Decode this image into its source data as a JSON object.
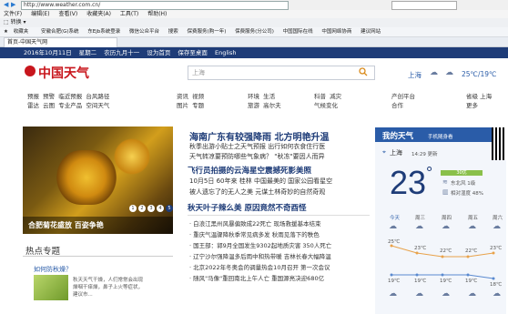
{
  "browser": {
    "address": "http://www.weather.com.cn/",
    "menu": [
      "文件(F)",
      "编辑(E)",
      "查看(V)",
      "收藏夹(A)",
      "工具(T)",
      "帮助(H)"
    ],
    "toolbar_label": "转换",
    "favorites": [
      "收藏夹",
      "安徽合肥(G)系统",
      "东Ejb系统登录",
      "微信公众平台",
      "搜索",
      "保费服务(购一年)",
      "保费服务(分公司)",
      "中国国际在线",
      "中国网络协商",
      "建议网站"
    ],
    "tab_label": "首页-中国天气网"
  },
  "site": {
    "topstrip": {
      "date": "2016年10月11日",
      "weekday": "星期二",
      "lunar": "农历九月十一",
      "set_home": "设为首页",
      "save_desktop": "保存至桌面",
      "english": "English"
    },
    "logo": "中国天气",
    "search": {
      "placeholder": "上海"
    },
    "top_weather": {
      "city": "上海",
      "temp": "25℃/19℃"
    },
    "nav": {
      "col1": [
        "预报",
        "雷达",
        "预警",
        "云图",
        "临近预报",
        "专业产品",
        "台风路径",
        "空间天气"
      ],
      "col2": [
        "资讯",
        "视频",
        "图片",
        "专题"
      ],
      "col3": [
        "环境",
        "生活",
        "旅游",
        "高尔夫"
      ],
      "col4": [
        "科普",
        "气候变化",
        "减灾"
      ],
      "col5": [
        "产创平台",
        "合作"
      ],
      "col6": [
        "省级",
        "上海",
        "更多"
      ]
    },
    "hero": {
      "caption": "合肥菊花盛放 百姿争艳",
      "dots": [
        "1",
        "2",
        "3",
        "4",
        "5"
      ]
    },
    "headlines": {
      "main": "海南广东有较强降雨 北方明艳升温",
      "main_lines": [
        "秋季出游小贴士之天气预报 出行如何衣食住行医",
        "天气转凉要预防哪些气象病？",
        "\"秋冻\"要因人而异"
      ],
      "second": "飞行员拍摄的云海星空震撼死影美照",
      "second_lines": [
        "10月5日 60年来 桂林 中国最美的 国家公园看星空",
        "被人遗忘了的无人之美 元谋土林奇妙的自然奇观"
      ],
      "third": "秋天叶子辣么美 原因竟然不奇酉怪",
      "bullets": [
        "白浪江黑州风暴偏致成22死亡 现场救援基本结束",
        "重庆气温骤降秋季常见病多发 秋雨见落下的秩色",
        "国王部：郭9月全国发生9302起地质灾害 350人死亡",
        "辽宁沙尔强降温多后雨中和热带暖 吉林长春大幅降温",
        "北京2022年冬奥会的调量热会10月召开 第一次会议",
        "随风\"马像\"重回南北上午人亡 重国源亮决迎680亿"
      ]
    },
    "hot": {
      "title": "热点专题",
      "link": "如何防秋燥？",
      "card_lines": [
        "秋天天气干燥，人们常常会出现",
        "燥咽干痒燥，鼻子上火等症状，",
        "建议市..."
      ]
    },
    "my_weather": {
      "title": "我的天气",
      "subtitle": "手机随身看",
      "city": "上海",
      "update": "14:29 更新",
      "temp": "23",
      "unit": "°",
      "aqi": "30优",
      "wind": "东北风 1级",
      "humidity": "相对湿度 48%",
      "days": [
        "今天",
        "周三",
        "周四",
        "周五",
        "周六"
      ],
      "highs": [
        "25℃",
        "23℃",
        "22℃",
        "22℃",
        "23℃"
      ],
      "lows": [
        "19℃",
        "19℃",
        "19℃",
        "19℃",
        "18℃"
      ]
    }
  }
}
